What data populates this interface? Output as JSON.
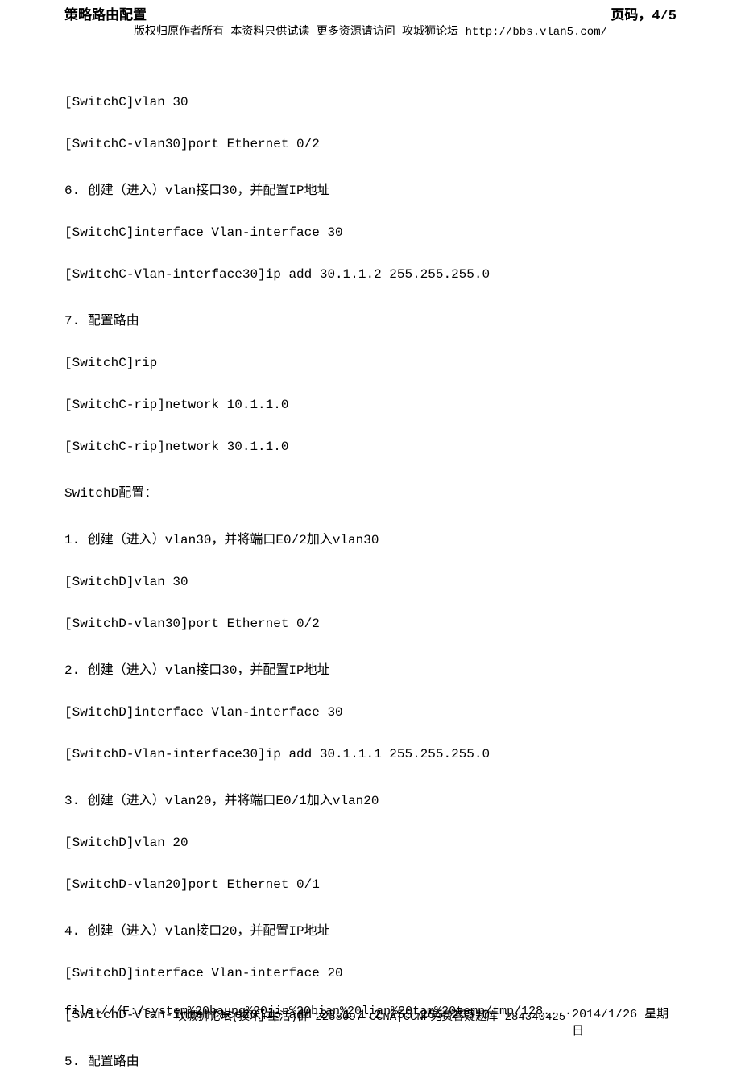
{
  "header": {
    "title": "策略路由配置",
    "page_label": "页码，4/5",
    "copyright": "版权归原作者所有 本资料只供试读 更多资源请访问 攻城狮论坛 http://bbs.vlan5.com/"
  },
  "lines": [
    "[SwitchC]vlan 30",
    "[SwitchC-vlan30]port Ethernet 0/2",
    "6. 创建（进入）vlan接口30，并配置IP地址",
    "[SwitchC]interface Vlan-interface 30",
    "[SwitchC-Vlan-interface30]ip add 30.1.1.2 255.255.255.0",
    "7. 配置路由",
    "[SwitchC]rip",
    "[SwitchC-rip]network 10.1.1.0",
    "[SwitchC-rip]network 30.1.1.0",
    "SwitchD配置：",
    "1. 创建（进入）vlan30，并将端口E0/2加入vlan30",
    "[SwitchD]vlan 30",
    "[SwitchD-vlan30]port Ethernet 0/2",
    "2. 创建（进入）vlan接口30，并配置IP地址",
    "[SwitchD]interface Vlan-interface 30",
    "[SwitchD-Vlan-interface30]ip add 30.1.1.1 255.255.255.0",
    "3. 创建（进入）vlan20，并将端口E0/1加入vlan20",
    "[SwitchD]vlan 20",
    "[SwitchD-vlan20]port Ethernet 0/1",
    "4. 创建（进入）vlan接口20，并配置IP地址",
    "[SwitchD]interface Vlan-interface 20",
    "[SwitchD-Vlan-interface20]ip add 20.1.1.2 255.255.255.0",
    "5. 配置路由"
  ],
  "footer": {
    "note": "攻城狮论坛(技术+生活)群 2258097 CCNA|CCNP免费答疑题库 284340425",
    "path": "file:///F:/system%20haung%20jin%20bian%20lian%20tam%20temp/tmp/128....",
    "date": "2014/1/26 星期日"
  }
}
